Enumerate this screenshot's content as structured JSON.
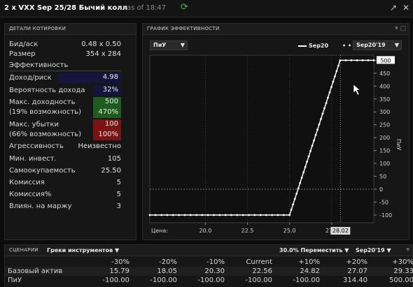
{
  "window": {
    "title": "2 x VXX Sep 25/28 Бычий колл",
    "as_of": "as of 18:47"
  },
  "quote": {
    "header": "ДЕТАЛИ КОТИРОВКИ",
    "bid_ask_label": "Бид/аск",
    "bid_ask_value": "0.48 x 0.50",
    "size_label": "Размер",
    "size_value": "354 x 284",
    "efficiency_label": "Эффективность",
    "return_risk_label": "Доход/риск",
    "return_risk_value": "4.98",
    "prob_profit_label": "Вероятность дохода",
    "prob_profit_value": "32%",
    "max_return_label": "Макс. доходность",
    "max_return_sub": "(19% возможность)",
    "max_return_value": "500",
    "max_return_pct": "470%",
    "max_loss_label": "Макс. убытки",
    "max_loss_sub": "(66% возможность)",
    "max_loss_value": "100",
    "max_loss_pct": "100%",
    "aggressiveness_label": "Агрессивность",
    "aggressiveness_value": "Неизвестно",
    "min_invest_label": "Мин. инвест.",
    "min_invest_value": "105",
    "breakeven_label": "Самоокупаемость",
    "breakeven_value": "25.50",
    "commission_label": "Комиссия",
    "commission_value": "5",
    "commission_pct_label": "Комиссия%",
    "commission_pct_value": "5",
    "margin_label": "Влиян. на маржу",
    "margin_value": "3"
  },
  "chart_panel": {
    "header": "ГРАФИК ЭФФЕКТИВНОСТИ",
    "metric_dropdown": "ПиУ",
    "legend_line": "Sep20",
    "legend_dots": "Sep20'19",
    "price_label": "Цена:",
    "price_marker": "28.02",
    "y_axis_label": "ПиУ"
  },
  "chart_data": {
    "type": "line",
    "xlabel": "Цена:",
    "ylabel": "ПиУ",
    "xlim": [
      16.7,
      30.0
    ],
    "ylim": [
      -130,
      520
    ],
    "x_ticks": [
      "20.0",
      "22.5",
      "25.0",
      "27.5"
    ],
    "x_tick_values": [
      20.0,
      22.5,
      25.0,
      27.5
    ],
    "y_ticks": [
      "500",
      "450",
      "400",
      "350",
      "300",
      "250",
      "200",
      "150",
      "100",
      "50",
      "0",
      "-50",
      "-100"
    ],
    "y_tick_values": [
      500,
      450,
      400,
      350,
      300,
      250,
      200,
      150,
      100,
      50,
      0,
      -50,
      -100
    ],
    "series": [
      {
        "name": "Sep20'19",
        "x": [
          16.7,
          25.0,
          28.0,
          30.0
        ],
        "y": [
          -100,
          -100,
          500,
          500
        ]
      }
    ],
    "current_price": 28.02,
    "current_value": 500,
    "colors": {
      "line": "#ffffff",
      "grid": "#5a5a5a",
      "zero_line": "#8a8a8a",
      "bg": "#101010"
    }
  },
  "scenarios": {
    "header": "СЦЕНАРИИ",
    "instrument_dropdown": "Греки инструментов",
    "shift_dropdown": "30.0% Переместить",
    "expiry_dropdown": "Sep20'19",
    "columns": [
      "-30%",
      "-20%",
      "-10%",
      "Current",
      "+10%",
      "+20%",
      "+30%"
    ],
    "rows": [
      {
        "label": "Базовый актив",
        "values": [
          "15.79",
          "18.05",
          "20.30",
          "22.56",
          "24.82",
          "27.07",
          "29.33"
        ]
      },
      {
        "label": "ПиУ",
        "values": [
          "-100.00",
          "-100.00",
          "-100.00",
          "-100.00",
          "-100.00",
          "314.40",
          "500.00"
        ]
      }
    ]
  },
  "colors": {
    "return_risk_bg": "#14143c",
    "prob_bg": "#14143c",
    "green_bg": "#1d5c1d",
    "red_bg": "#7a1414"
  }
}
